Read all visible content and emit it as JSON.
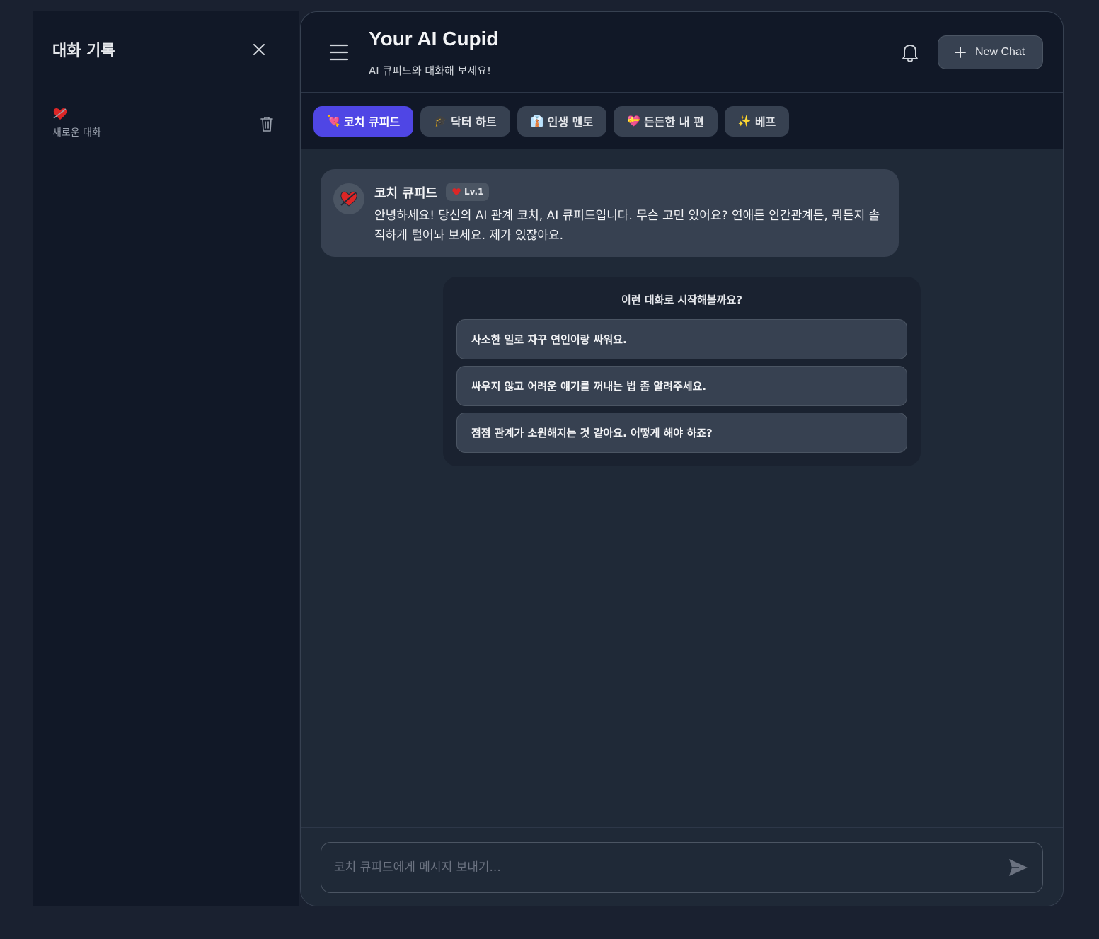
{
  "sidebar": {
    "title": "대화 기록",
    "conversations": [
      {
        "emoji": "heart-emoji",
        "title": "새로운 대화"
      }
    ]
  },
  "header": {
    "title": "Your AI Cupid",
    "subtitle": "AI 큐피드와 대화해 보세요!",
    "new_chat_label": "New Chat"
  },
  "tabs": [
    {
      "emoji": "💘",
      "label": "코치 큐피드",
      "active": true
    },
    {
      "emoji": "🎓",
      "label": "닥터 하트",
      "active": false
    },
    {
      "emoji": "👔",
      "label": "인생 멘토",
      "active": false
    },
    {
      "emoji": "💝",
      "label": "든든한 내 편",
      "active": false
    },
    {
      "emoji": "✨",
      "label": "베프",
      "active": false
    }
  ],
  "message": {
    "bot_name": "코치 큐피드",
    "level": "Lv.1",
    "text": "안녕하세요! 당신의 AI 관계 코치, AI 큐피드입니다. 무슨 고민 있어요? 연애든 인간관계든, 뭐든지 솔직하게 털어놔 보세요. 제가 있잖아요."
  },
  "suggestions": {
    "title": "이런 대화로 시작해볼까요?",
    "items": [
      "사소한 일로 자꾸 연인이랑 싸워요.",
      "싸우지 않고 어려운 얘기를 꺼내는 법 좀 알려주세요.",
      "점점 관계가 소원해지는 것 같아요. 어떻게 해야 하죠?"
    ]
  },
  "input": {
    "placeholder": "코치 큐피드에게 메시지 보내기..."
  },
  "colors": {
    "accent": "#4f46e5",
    "background": "#1f2937",
    "sidebar": "#111827"
  }
}
